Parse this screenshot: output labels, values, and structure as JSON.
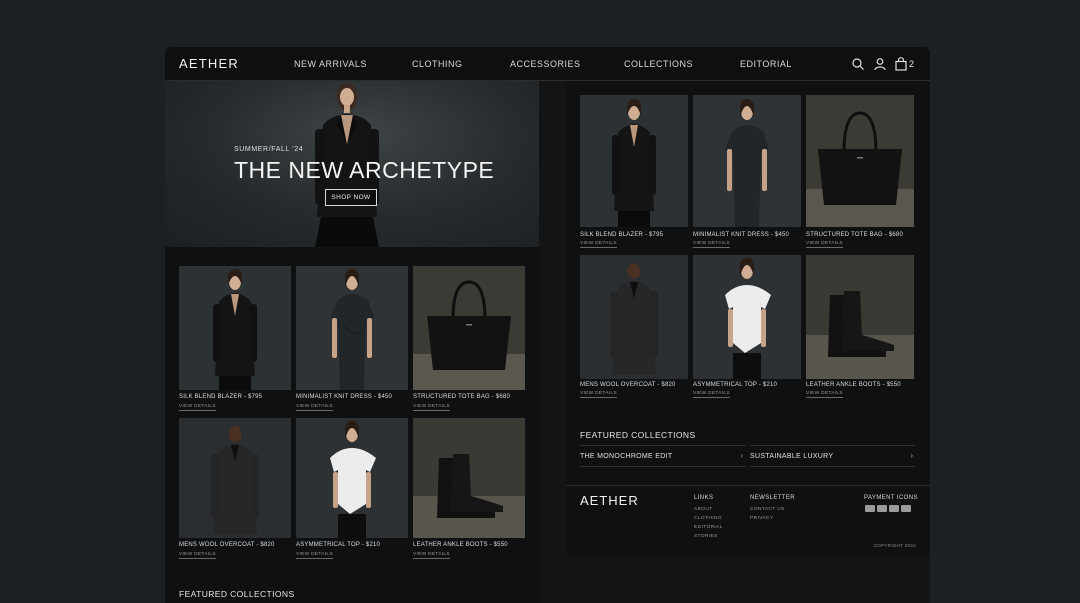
{
  "brand": {
    "name": "AETHER"
  },
  "nav": {
    "items": [
      "NEW ARRIVALS",
      "CLOTHING",
      "ACCESSORIES",
      "COLLECTIONS",
      "EDITORIAL"
    ],
    "icons": [
      "search-icon",
      "user-icon",
      "bag-icon"
    ],
    "cart_count": "2"
  },
  "hero": {
    "kicker": "SUMMER/FALL '24",
    "title": "THE NEW ARCHETYPE",
    "button_label": "SHOP NOW"
  },
  "products": [
    {
      "name": "SILK BLEND BLAZER - $795",
      "link": "VIEW DETAILS"
    },
    {
      "name": "MINIMALIST KNIT DRESS - $450",
      "link": "VIEW DETAILS"
    },
    {
      "name": "STRUCTURED TOTE BAG - $680",
      "link": "VIEW DETAILS"
    },
    {
      "name": "MENS WOOL OVERCOAT - $820",
      "link": "VIEW DETAILS"
    },
    {
      "name": "ASYMMETRICAL TOP - $210",
      "link": "VIEW DETAILS"
    },
    {
      "name": "LEATHER ANKLE BOOTS - $550",
      "link": "VIEW DETAILS"
    }
  ],
  "featured": {
    "heading": "FEATURED COLLECTIONS",
    "collections": [
      "THE MONOCHROME EDIT",
      "SUSTAINABLE LUXURY"
    ]
  },
  "footer": {
    "logo": "AETHER",
    "links_heading": "LINKS",
    "links": [
      "ABOUT",
      "CLOTHING",
      "EDITORIAL",
      "STORIES"
    ],
    "newsletter_heading": "NEWSLETTER",
    "newsletter_links": [
      "CONTACT US",
      "PRIVACY"
    ],
    "payment_heading": "PAYMENT ICONS",
    "copyright": "COPYRIGHT 2024"
  },
  "colors": {
    "page_bg": "#1c2024",
    "panel_bg": "#0f1011",
    "text": "#e8e8e8",
    "muted": "#9a9a9a"
  }
}
